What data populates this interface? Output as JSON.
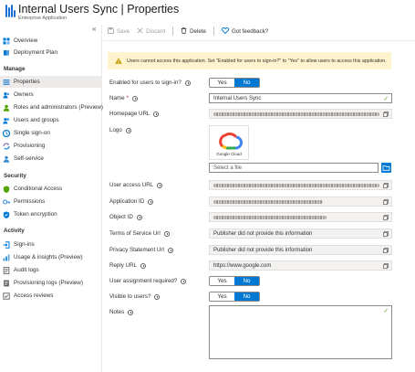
{
  "header": {
    "title": "Internal Users Sync | Properties",
    "subtitle": "Enterprise Application",
    "more": "···"
  },
  "sidebar": {
    "collapse": "«",
    "top_items": [
      {
        "label": "Overview",
        "icon": "overview-icon",
        "color": "#0078d4"
      },
      {
        "label": "Deployment Plan",
        "icon": "book-icon",
        "color": "#0078d4"
      }
    ],
    "manage_header": "Manage",
    "manage_items": [
      {
        "label": "Properties",
        "icon": "properties-icon",
        "color": "#3b8cd6"
      },
      {
        "label": "Owners",
        "icon": "owners-icon",
        "color": "#0078d4"
      },
      {
        "label": "Roles and administrators (Preview)",
        "icon": "roles-icon",
        "color": "#57a300"
      },
      {
        "label": "Users and groups",
        "icon": "users-icon",
        "color": "#0078d4"
      },
      {
        "label": "Single sign-on",
        "icon": "sso-icon",
        "color": "#0078d4"
      },
      {
        "label": "Provisioning",
        "icon": "provisioning-icon",
        "color": "#8764b8"
      },
      {
        "label": "Self-service",
        "icon": "self-service-icon",
        "color": "#3b8cd6"
      }
    ],
    "security_header": "Security",
    "security_items": [
      {
        "label": "Conditional Access",
        "icon": "conditional-access-icon",
        "color": "#57a300"
      },
      {
        "label": "Permissions",
        "icon": "permissions-icon",
        "color": "#3b8cd6"
      },
      {
        "label": "Token encryption",
        "icon": "shield-icon",
        "color": "#0078d4"
      }
    ],
    "activity_header": "Activity",
    "activity_items": [
      {
        "label": "Sign-ins",
        "icon": "sign-ins-icon",
        "color": "#0078d4"
      },
      {
        "label": "Usage & insights (Preview)",
        "icon": "chart-icon",
        "color": "#3b8cd6"
      },
      {
        "label": "Audit logs",
        "icon": "audit-logs-icon",
        "color": "#605e5c"
      },
      {
        "label": "Provisioning logs (Preview)",
        "icon": "provisioning-logs-icon",
        "color": "#605e5c"
      },
      {
        "label": "Access reviews",
        "icon": "access-reviews-icon",
        "color": "#605e5c"
      }
    ]
  },
  "toolbar": {
    "save": "Save",
    "discard": "Discard",
    "delete": "Delete",
    "feedback": "Got feedback?"
  },
  "warning": "Users cannot access this application. Set \"Enabled for users to sign-in?\" to \"Yes\" to allow users to access this application.",
  "form": {
    "enabled_label": "Enabled for users to sign-in?",
    "enabled_yes": "Yes",
    "enabled_no": "No",
    "enabled_value": "No",
    "name_label": "Name",
    "name_required": "*",
    "name_value": "Internal Users Sync",
    "homepage_label": "Homepage URL",
    "logo_label": "Logo",
    "logo_caption": "Google Cloud",
    "file_placeholder": "Select a file",
    "access_url_label": "User access URL",
    "app_id_label": "Application ID",
    "object_id_label": "Object ID",
    "tos_label": "Terms of Service Url",
    "tos_value": "Publisher did not provide this information",
    "privacy_label": "Privacy Statement Url",
    "privacy_value": "Publisher did not provide this information",
    "reply_label": "Reply URL",
    "reply_value": "https://www.google.com",
    "assignment_label": "User assignment required?",
    "assignment_yes": "Yes",
    "assignment_no": "No",
    "assignment_value": "No",
    "visible_label": "Visible to users?",
    "visible_yes": "Yes",
    "visible_no": "No",
    "visible_value": "No",
    "notes_label": "Notes"
  },
  "colors": {
    "accent": "#0078d4",
    "warning_bg": "#fff4ce",
    "warning_icon": "#c19c00",
    "valid_check": "#57a300"
  }
}
